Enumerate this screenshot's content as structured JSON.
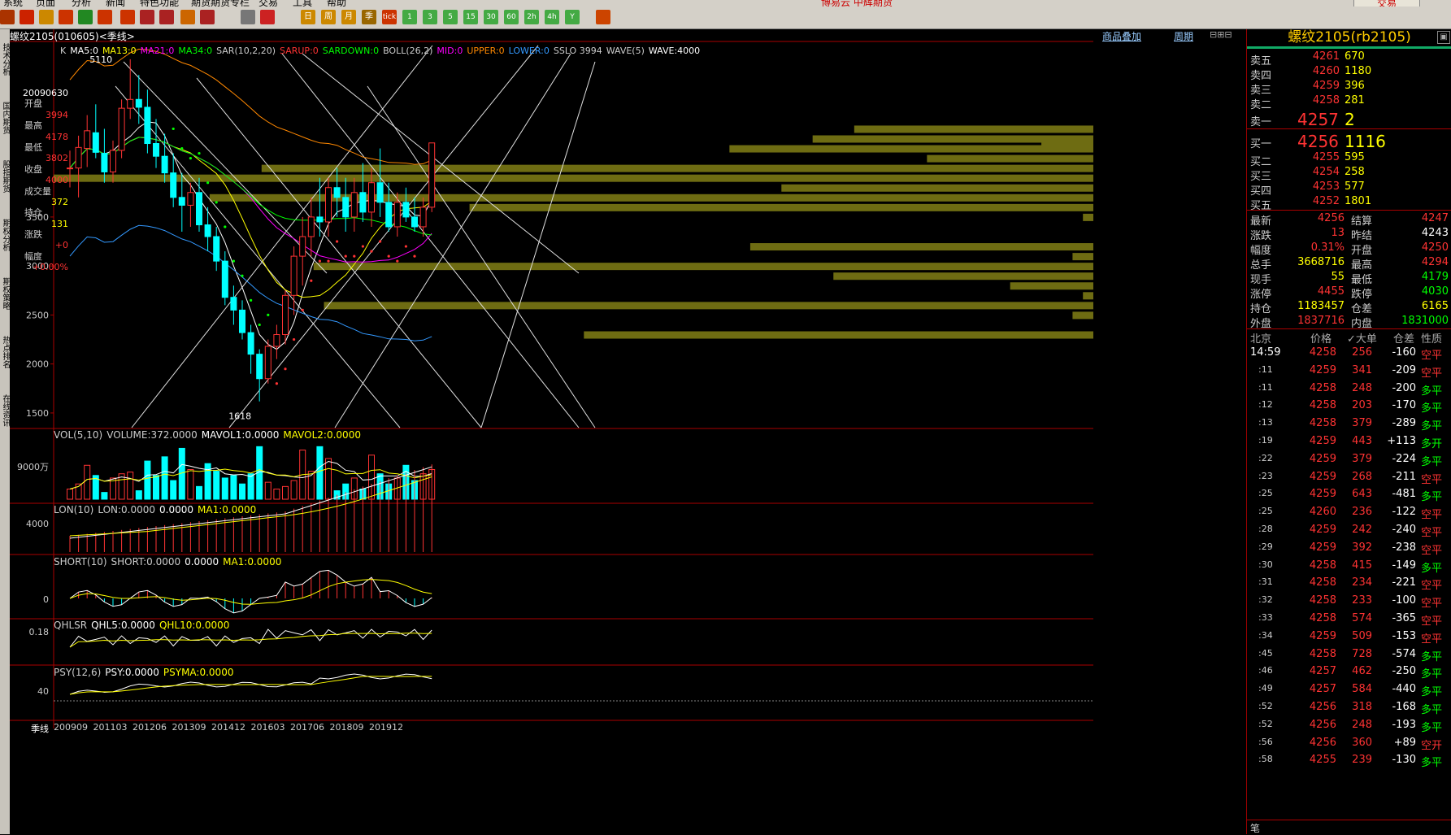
{
  "menu": {
    "items": [
      "系统",
      "页面",
      "分析",
      "新闻",
      "特色功能",
      "期货期货专栏",
      "交易",
      "工具",
      "帮助"
    ],
    "title": "博易云 中辉期货",
    "trade_button": "交易"
  },
  "toolbar": {
    "buttons": [
      "tick",
      "1",
      "3",
      "5",
      "15",
      "30",
      "60",
      "2h",
      "4h",
      "Y"
    ]
  },
  "left_tabs": [
    "技术分析",
    "国内期货",
    "股指期货",
    "期权分析",
    "期权策略",
    "热点排名",
    "在线资讯"
  ],
  "chart_header": {
    "title": "螺纹2105(010605)<季线>",
    "overlay_link": "商品叠加",
    "period_link": "周期"
  },
  "info_panel": {
    "date": "20090630",
    "open_label": "开盘",
    "open": "3994",
    "high_label": "最高",
    "high": "4178",
    "low_label": "最低",
    "low": "3802",
    "close_label": "收盘",
    "close": "4000",
    "volume_label": "成交量",
    "volume": "372",
    "oi_label": "持仓",
    "oi": "131",
    "change_label": "涨跌",
    "change": "+0",
    "range_label": "幅度",
    "range": "+0.00%"
  },
  "main_indicators": [
    {
      "text": "K",
      "color": "#cccccc"
    },
    {
      "text": "MA5:0",
      "color": "#ffffff"
    },
    {
      "text": "MA13:0",
      "color": "#ffff00"
    },
    {
      "text": "MA21:0",
      "color": "#ff00ff"
    },
    {
      "text": "MA34:0",
      "color": "#00ff00"
    },
    {
      "text": "SAR(10,2,20)",
      "color": "#cccccc"
    },
    {
      "text": "SARUP:0",
      "color": "#ff3333"
    },
    {
      "text": "SARDOWN:0",
      "color": "#00ff00"
    },
    {
      "text": "BOLL(26,2)",
      "color": "#cccccc"
    },
    {
      "text": "MID:0",
      "color": "#ff00ff"
    },
    {
      "text": "UPPER:0",
      "color": "#ff8800"
    },
    {
      "text": "LOWER:0",
      "color": "#3399ff"
    },
    {
      "text": "SSLO 3994",
      "color": "#cccccc"
    },
    {
      "text": "WAVE(5)",
      "color": "#cccccc"
    },
    {
      "text": "WAVE:4000",
      "color": "#ffffff"
    }
  ],
  "price_axis": [
    "3500",
    "3000",
    "2500",
    "2000",
    "1500"
  ],
  "wave_labels": {
    "high": "5110",
    "low": "1618"
  },
  "panels": [
    {
      "header": [
        {
          "text": "VOL(5,10)",
          "color": "#cccccc"
        },
        {
          "text": "VOLUME:372.0000",
          "color": "#cccccc"
        },
        {
          "text": "MAVOL1:0.0000",
          "color": "#ffffff"
        },
        {
          "text": "MAVOL2:0.0000",
          "color": "#ffff00"
        }
      ],
      "axis": "9000万"
    },
    {
      "header": [
        {
          "text": "LON(10)",
          "color": "#cccccc"
        },
        {
          "text": "LON:0.0000",
          "color": "#cccccc"
        },
        {
          "text": "0.0000",
          "color": "#ffffff"
        },
        {
          "text": "MA1:0.0000",
          "color": "#ffff00"
        }
      ],
      "axis": "4000"
    },
    {
      "header": [
        {
          "text": "SHORT(10)",
          "color": "#cccccc"
        },
        {
          "text": "SHORT:0.0000",
          "color": "#cccccc"
        },
        {
          "text": "0.0000",
          "color": "#ffffff"
        },
        {
          "text": "MA1:0.0000",
          "color": "#ffff00"
        }
      ],
      "axis": "0"
    },
    {
      "header": [
        {
          "text": "QHLSR",
          "color": "#cccccc"
        },
        {
          "text": "QHL5:0.0000",
          "color": "#ffffff"
        },
        {
          "text": "QHL10:0.0000",
          "color": "#ffff00"
        }
      ],
      "axis": "0.18"
    },
    {
      "header": [
        {
          "text": "PSY(12,6)",
          "color": "#cccccc"
        },
        {
          "text": "PSY:0.0000",
          "color": "#ffffff"
        },
        {
          "text": "PSYMA:0.0000",
          "color": "#ffff00"
        }
      ],
      "axis": "40"
    }
  ],
  "x_axis": {
    "period": "季线",
    "ticks": [
      "200909",
      "201103",
      "201206",
      "201309",
      "201412",
      "201603",
      "201706",
      "201809",
      "201912"
    ]
  },
  "quote": {
    "title": "螺纹2105(rb2105)",
    "asks": [
      {
        "label": "卖五",
        "price": "4261",
        "vol": "670"
      },
      {
        "label": "卖四",
        "price": "4260",
        "vol": "1180"
      },
      {
        "label": "卖三",
        "price": "4259",
        "vol": "396"
      },
      {
        "label": "卖二",
        "price": "4258",
        "vol": "281"
      },
      {
        "label": "卖一",
        "price": "4257",
        "vol": "2"
      }
    ],
    "bids": [
      {
        "label": "买一",
        "price": "4256",
        "vol": "1116"
      },
      {
        "label": "买二",
        "price": "4255",
        "vol": "595"
      },
      {
        "label": "买三",
        "price": "4254",
        "vol": "258"
      },
      {
        "label": "买四",
        "price": "4253",
        "vol": "577"
      },
      {
        "label": "买五",
        "price": "4252",
        "vol": "1801"
      }
    ],
    "stats": [
      {
        "l1": "最新",
        "v1": "4256",
        "c1": "#ff3333",
        "l2": "结算",
        "v2": "4247",
        "c2": "#ff3333"
      },
      {
        "l1": "涨跌",
        "v1": "13",
        "c1": "#ff3333",
        "l2": "昨结",
        "v2": "4243",
        "c2": "#ffffff"
      },
      {
        "l1": "幅度",
        "v1": "0.31%",
        "c1": "#ff3333",
        "l2": "开盘",
        "v2": "4250",
        "c2": "#ff3333"
      },
      {
        "l1": "总手",
        "v1": "3668716",
        "c1": "#ffff00",
        "l2": "最高",
        "v2": "4294",
        "c2": "#ff3333"
      },
      {
        "l1": "现手",
        "v1": "55",
        "c1": "#ffff00",
        "l2": "最低",
        "v2": "4179",
        "c2": "#00ff00"
      },
      {
        "l1": "涨停",
        "v1": "4455",
        "c1": "#ff3333",
        "l2": "跌停",
        "v2": "4030",
        "c2": "#00ff00"
      },
      {
        "l1": "持仓",
        "v1": "1183457",
        "c1": "#ffff00",
        "l2": "仓差",
        "v2": "6165",
        "c2": "#ffff00"
      },
      {
        "l1": "外盘",
        "v1": "1837716",
        "c1": "#ff3333",
        "l2": "内盘",
        "v2": "1831000",
        "c2": "#00ff00"
      }
    ],
    "tick_header": [
      "北京",
      "价格",
      "✓大单",
      "仓差",
      "性质"
    ],
    "ticks": [
      {
        "t": "14:59",
        "p": "4258",
        "v": "256",
        "d": "-160",
        "n": "空平"
      },
      {
        "t": ":11",
        "p": "4259",
        "v": "341",
        "d": "-209",
        "n": "空平"
      },
      {
        "t": ":11",
        "p": "4258",
        "v": "248",
        "d": "-200",
        "n": "多平"
      },
      {
        "t": ":12",
        "p": "4258",
        "v": "203",
        "d": "-170",
        "n": "多平"
      },
      {
        "t": ":13",
        "p": "4258",
        "v": "379",
        "d": "-289",
        "n": "多平"
      },
      {
        "t": ":19",
        "p": "4259",
        "v": "443",
        "d": "+113",
        "n": "多开"
      },
      {
        "t": ":22",
        "p": "4259",
        "v": "379",
        "d": "-224",
        "n": "多平"
      },
      {
        "t": ":23",
        "p": "4259",
        "v": "268",
        "d": "-211",
        "n": "空平"
      },
      {
        "t": ":25",
        "p": "4259",
        "v": "643",
        "d": "-481",
        "n": "多平"
      },
      {
        "t": ":25",
        "p": "4260",
        "v": "236",
        "d": "-122",
        "n": "空平"
      },
      {
        "t": ":28",
        "p": "4259",
        "v": "242",
        "d": "-240",
        "n": "空平"
      },
      {
        "t": ":29",
        "p": "4259",
        "v": "392",
        "d": "-238",
        "n": "空平"
      },
      {
        "t": ":30",
        "p": "4258",
        "v": "415",
        "d": "-149",
        "n": "多平"
      },
      {
        "t": ":31",
        "p": "4258",
        "v": "234",
        "d": "-221",
        "n": "空平"
      },
      {
        "t": ":32",
        "p": "4258",
        "v": "233",
        "d": "-100",
        "n": "空平"
      },
      {
        "t": ":33",
        "p": "4258",
        "v": "574",
        "d": "-365",
        "n": "空平"
      },
      {
        "t": ":34",
        "p": "4259",
        "v": "509",
        "d": "-153",
        "n": "空平"
      },
      {
        "t": ":45",
        "p": "4258",
        "v": "728",
        "d": "-574",
        "n": "多平"
      },
      {
        "t": ":46",
        "p": "4257",
        "v": "462",
        "d": "-250",
        "n": "多平"
      },
      {
        "t": ":49",
        "p": "4257",
        "v": "584",
        "d": "-440",
        "n": "多平"
      },
      {
        "t": ":52",
        "p": "4256",
        "v": "318",
        "d": "-168",
        "n": "多平"
      },
      {
        "t": ":52",
        "p": "4256",
        "v": "248",
        "d": "-193",
        "n": "多平"
      },
      {
        "t": ":56",
        "p": "4256",
        "v": "360",
        "d": "+89",
        "n": "空开"
      },
      {
        "t": ":58",
        "p": "4255",
        "v": "239",
        "d": "-130",
        "n": "多平"
      }
    ],
    "footer_tab": "笔"
  },
  "candles": [
    [
      3994,
      4178,
      3802,
      4000
    ],
    [
      4000,
      4330,
      3700,
      4210
    ],
    [
      4200,
      4540,
      4010,
      4380
    ],
    [
      4360,
      4650,
      4100,
      4160
    ],
    [
      4150,
      4400,
      3850,
      3960
    ],
    [
      3960,
      4280,
      3850,
      4180
    ],
    [
      4180,
      4700,
      4100,
      4610
    ],
    [
      4610,
      5110,
      4500,
      4700
    ],
    [
      4700,
      4950,
      4450,
      4620
    ],
    [
      4620,
      4800,
      4150,
      4250
    ],
    [
      4250,
      4500,
      4000,
      4120
    ],
    [
      4120,
      4350,
      3850,
      3950
    ],
    [
      3950,
      4150,
      3600,
      3700
    ],
    [
      3700,
      3950,
      3350,
      3620
    ],
    [
      3620,
      3850,
      3400,
      3750
    ],
    [
      3750,
      3900,
      3350,
      3420
    ],
    [
      3420,
      3600,
      3150,
      3300
    ],
    [
      3300,
      3400,
      2950,
      3050
    ],
    [
      3050,
      3150,
      2600,
      2680
    ],
    [
      2680,
      2800,
      2400,
      2550
    ],
    [
      2550,
      2650,
      2250,
      2320
    ],
    [
      2320,
      2400,
      1900,
      2100
    ],
    [
      2100,
      2150,
      1618,
      1850
    ],
    [
      1850,
      2250,
      1800,
      2180
    ],
    [
      2180,
      2400,
      2050,
      2300
    ],
    [
      2300,
      2750,
      2200,
      2700
    ],
    [
      2700,
      3200,
      2500,
      3100
    ],
    [
      3100,
      3500,
      2800,
      3300
    ],
    [
      3300,
      3700,
      3100,
      3500
    ],
    [
      3500,
      3900,
      3300,
      3450
    ],
    [
      3450,
      3900,
      3300,
      3800
    ],
    [
      3800,
      4000,
      3500,
      3700
    ],
    [
      3700,
      3900,
      3350,
      3500
    ],
    [
      3500,
      3900,
      3350,
      3750
    ],
    [
      3750,
      4050,
      3450,
      3550
    ],
    [
      3550,
      4000,
      3400,
      3850
    ],
    [
      3850,
      4200,
      3500,
      3650
    ],
    [
      3650,
      3850,
      3350,
      3400
    ],
    [
      3400,
      3750,
      3300,
      3650
    ],
    [
      3650,
      3800,
      3450,
      3500
    ],
    [
      3500,
      3700,
      3350,
      3400
    ],
    [
      3400,
      3700,
      3300,
      3600
    ],
    [
      3600,
      4200,
      3550,
      4256
    ]
  ],
  "volume": [
    12,
    18,
    40,
    28,
    8,
    25,
    30,
    32,
    10,
    45,
    28,
    50,
    22,
    60,
    35,
    15,
    42,
    33,
    25,
    28,
    18,
    30,
    62,
    20,
    12,
    15,
    22,
    58,
    33,
    62,
    48,
    10,
    18,
    25,
    12,
    52,
    30,
    18,
    25,
    40,
    22,
    30,
    35
  ],
  "volume_profile": [
    {
      "price": 4400,
      "len": 0.23
    },
    {
      "price": 4300,
      "len": 0.27
    },
    {
      "price": 4250,
      "len": 0.05
    },
    {
      "price": 4200,
      "len": 0.35
    },
    {
      "price": 4100,
      "len": 0.16
    },
    {
      "price": 4000,
      "len": 0.8
    },
    {
      "price": 3900,
      "len": 1.0
    },
    {
      "price": 3800,
      "len": 0.3
    },
    {
      "price": 3700,
      "len": 0.85
    },
    {
      "price": 3600,
      "len": 0.6
    },
    {
      "price": 3500,
      "len": 0.01
    },
    {
      "price": 3200,
      "len": 0.33
    },
    {
      "price": 3100,
      "len": 0.02
    },
    {
      "price": 3000,
      "len": 0.75
    },
    {
      "price": 2900,
      "len": 0.25
    },
    {
      "price": 2800,
      "len": 0.08
    },
    {
      "price": 2700,
      "len": 0.01
    },
    {
      "price": 2600,
      "len": 0.74
    },
    {
      "price": 2500,
      "len": 0.02
    },
    {
      "price": 2300,
      "len": 0.49
    }
  ]
}
